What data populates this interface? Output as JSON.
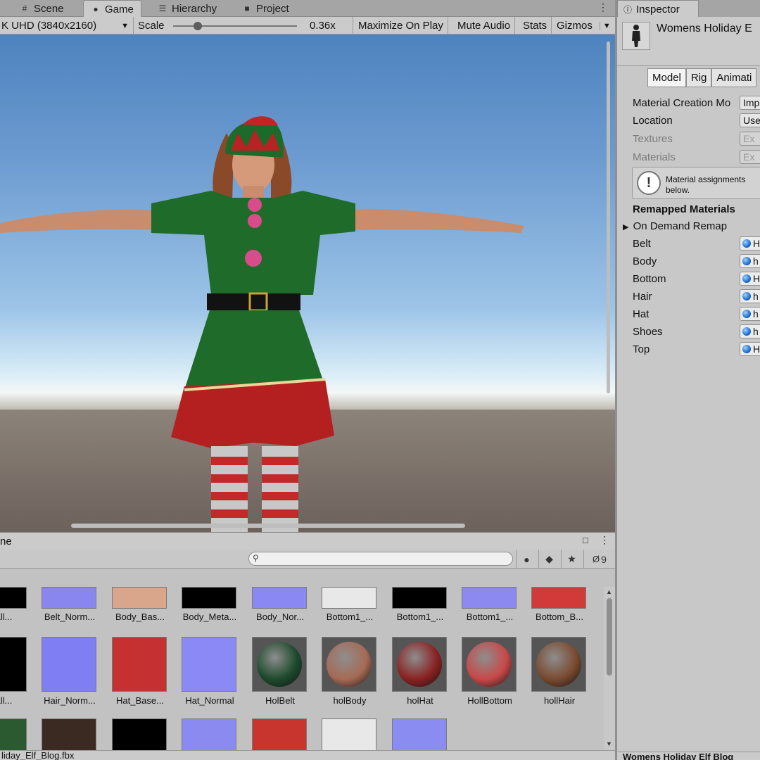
{
  "tabs": {
    "scene": "Scene",
    "game": "Game",
    "hierarchy": "Hierarchy",
    "project": "Project"
  },
  "gamebar": {
    "resolution": "K UHD (3840x2160)",
    "scale_label": "Scale",
    "scale_value": "0.36x",
    "scale_fraction": 0.2,
    "maximize": "Maximize On Play",
    "mute": "Mute Audio",
    "stats": "Stats",
    "gizmos": "Gizmos"
  },
  "project": {
    "header_title": "ne",
    "search_placeholder": "",
    "hidden_count": "9",
    "status_path": "liday_Elf_Blog.fbx",
    "rows": [
      [
        {
          "label": "etall...",
          "thumb": "#000000"
        },
        {
          "label": "Belt_Norm...",
          "thumb": "#8a86f0"
        },
        {
          "label": "Body_Bas...",
          "thumb": "#d9a58b"
        },
        {
          "label": "Body_Meta...",
          "thumb": "#000000"
        },
        {
          "label": "Body_Nor...",
          "thumb": "#8a88f2"
        },
        {
          "label": "Bottom1_...",
          "thumb": "#e8e8e8"
        },
        {
          "label": "Bottom1_...",
          "thumb": "#000000"
        },
        {
          "label": "Bottom1_...",
          "thumb": "#8c89f0"
        },
        {
          "label": "Bottom_B...",
          "thumb": "#d23a3a"
        }
      ],
      [
        {
          "label": "etall...",
          "thumb": "#000000"
        },
        {
          "label": "Hair_Norm...",
          "thumb": "#7f7ef2"
        },
        {
          "label": "Hat_Base...",
          "thumb": "#c53030"
        },
        {
          "label": "Hat_Normal",
          "thumb": "#8b89f5"
        },
        {
          "label": "HolBelt",
          "thumb": "#1d4a2c"
        },
        {
          "label": "holBody",
          "thumb": "#a66a55"
        },
        {
          "label": "holHat",
          "thumb": "#8a2222"
        },
        {
          "label": "HollBottom",
          "thumb": "#c84848"
        },
        {
          "label": "hollHair",
          "thumb": "#7a4a30"
        }
      ],
      [
        {
          "label": "",
          "thumb": "#2c5a30"
        },
        {
          "label": "",
          "thumb": "#3a2a22"
        },
        {
          "label": "",
          "thumb": "#000000"
        },
        {
          "label": "",
          "thumb": "#8a8af0"
        },
        {
          "label": "",
          "thumb": "#c8342e"
        },
        {
          "label": "",
          "thumb": "#e8e8e8"
        },
        {
          "label": "",
          "thumb": "#8a8cf2"
        }
      ]
    ]
  },
  "inspector": {
    "tab": "Inspector",
    "title": "Womens Holiday E",
    "buttons": [
      "Model",
      "Rig",
      "Animati"
    ],
    "material_creation_label": "Material Creation Mo",
    "material_creation_value": "Imp",
    "location_label": "Location",
    "location_value": "Use",
    "textures_label": "Textures",
    "textures_value": "Ex",
    "materials_label": "Materials",
    "materials_value": "Ex",
    "warning_line1": "Material assignments",
    "warning_line2": "below.",
    "remapped_header": "Remapped Materials",
    "on_demand": "On Demand Remap",
    "remaps": [
      {
        "label": "Belt",
        "value": "H"
      },
      {
        "label": "Body",
        "value": "h"
      },
      {
        "label": "Bottom",
        "value": "H"
      },
      {
        "label": "Hair",
        "value": "h"
      },
      {
        "label": "Hat",
        "value": "h"
      },
      {
        "label": "Shoes",
        "value": "h"
      },
      {
        "label": "Top",
        "value": "H"
      }
    ],
    "bottom_title": "Womens Holiday Elf Blog"
  },
  "colors": {
    "dress_green": "#1f6b2a",
    "skirt_red": "#b3201f",
    "sky_top": "#4e83bf",
    "panel_bg": "#c2c2c2"
  }
}
